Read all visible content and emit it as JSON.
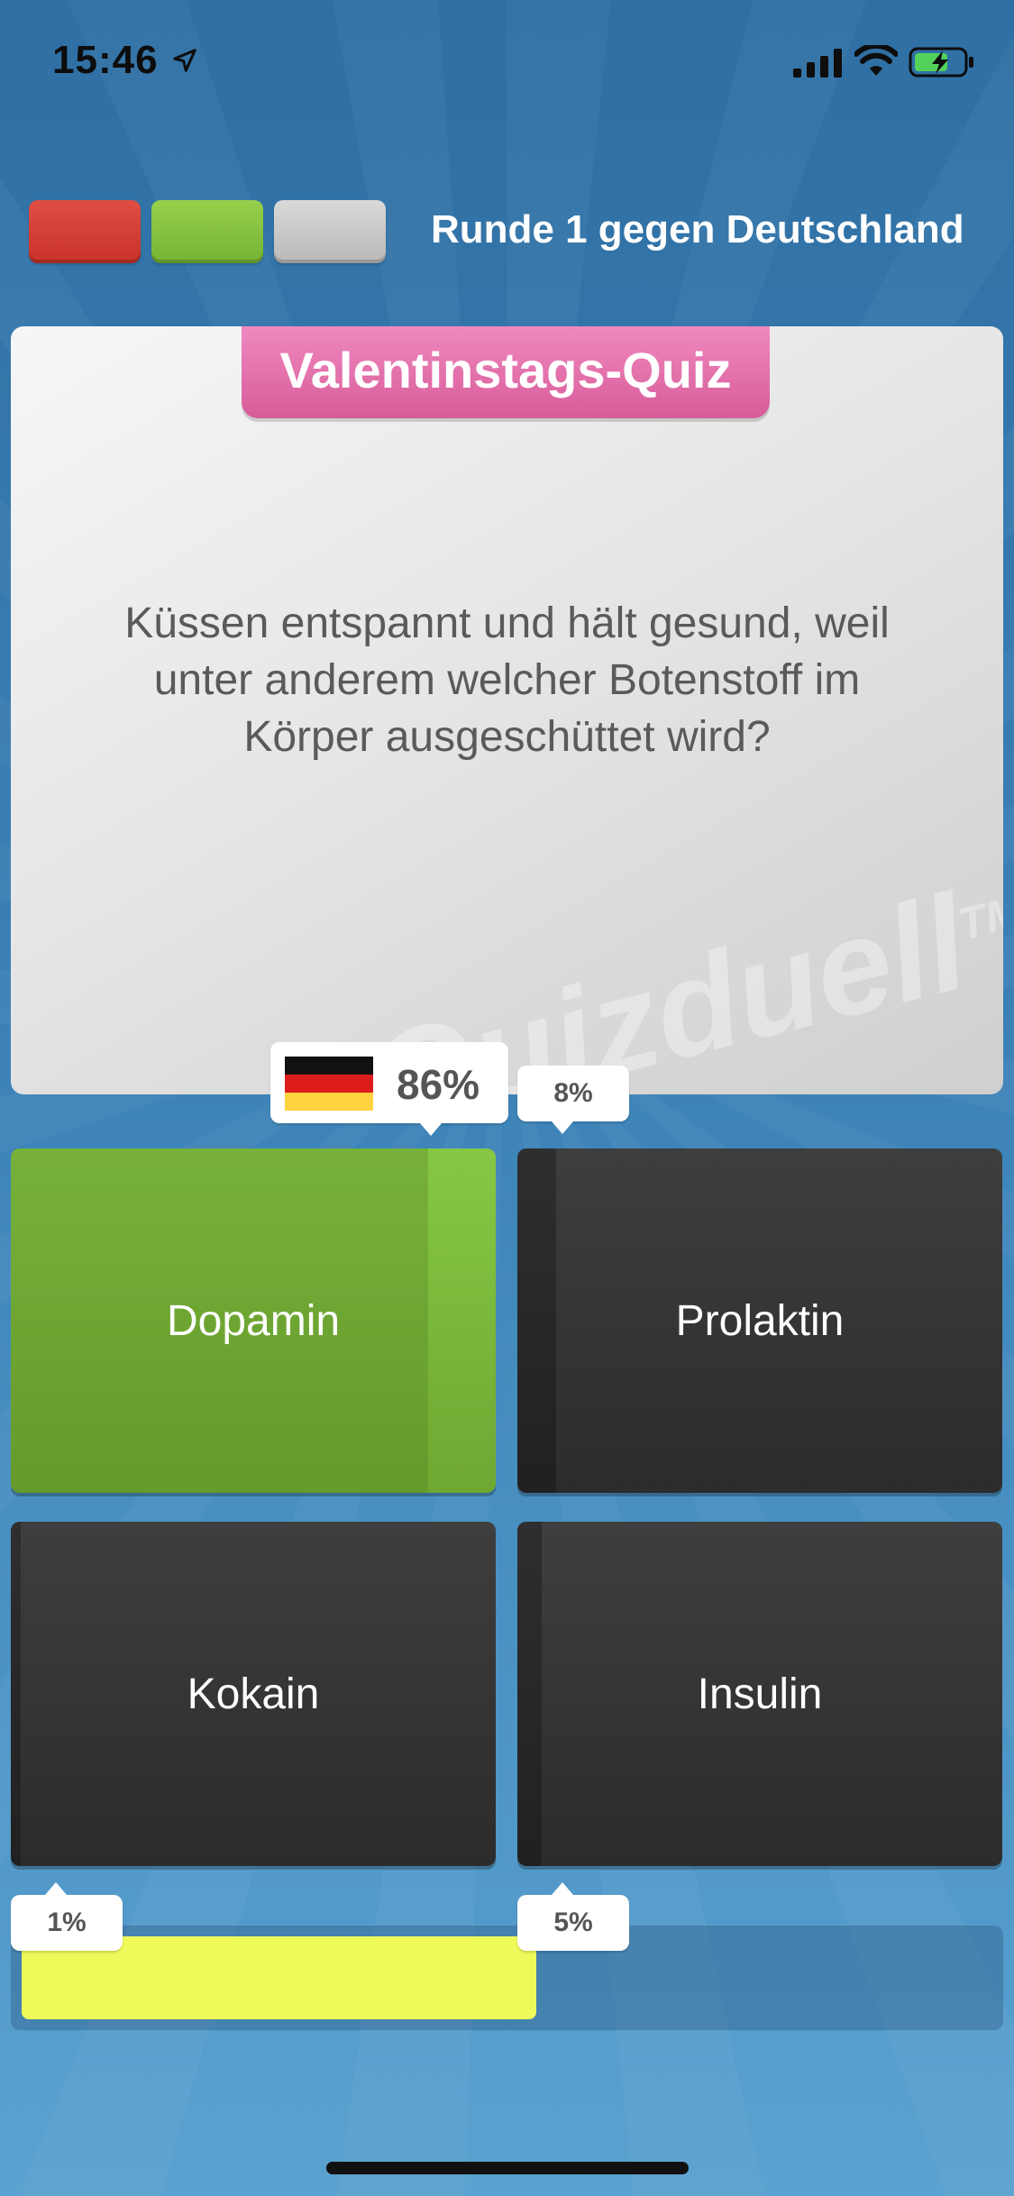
{
  "status_bar": {
    "time": "15:46",
    "icons": [
      "location-arrow-icon",
      "cellular-signal-icon",
      "wifi-icon",
      "battery-charging-icon"
    ]
  },
  "round": {
    "title": "Runde 1 gegen Deutschland",
    "results": [
      {
        "state": "wrong",
        "color": "#d63c33"
      },
      {
        "state": "correct",
        "color": "#86c444"
      },
      {
        "state": "pending",
        "color": "#c9c9c9"
      }
    ]
  },
  "question": {
    "category": "Valentinstags-Quiz",
    "text": "Küssen entspannt und hält gesund, weil unter anderem welcher Botenstoff im Körper ausgeschüttet wird?",
    "watermark": "Quizduell",
    "watermark_tm": "TM"
  },
  "answers": [
    {
      "label": "Dopamin",
      "percent": "86%",
      "share": 0.86,
      "correct": true,
      "flag": "germany-flag-icon"
    },
    {
      "label": "Prolaktin",
      "percent": "8%",
      "share": 0.08,
      "correct": false
    },
    {
      "label": "Kokain",
      "percent": "1%",
      "share": 0.01,
      "correct": false
    },
    {
      "label": "Insulin",
      "percent": "5%",
      "share": 0.05,
      "correct": false
    }
  ],
  "timer": {
    "remaining": 0.53,
    "color": "#eef95a"
  },
  "colors": {
    "correct": "#86c444",
    "category": "#e26aa7",
    "background": "#3a80b6"
  }
}
